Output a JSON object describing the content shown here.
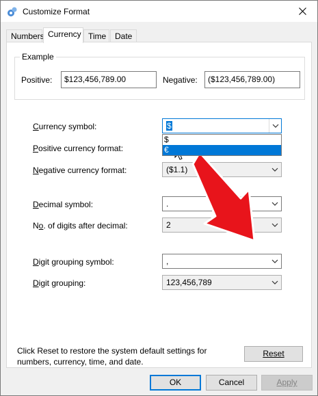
{
  "window": {
    "title": "Customize Format",
    "close_icon": "close-icon"
  },
  "tabs": [
    {
      "label": "Numbers",
      "active": false
    },
    {
      "label": "Currency",
      "active": true
    },
    {
      "label": "Time",
      "active": false
    },
    {
      "label": "Date",
      "active": false
    }
  ],
  "example": {
    "legend": "Example",
    "positive_label": "Positive:",
    "positive_value": "$123,456,789.00",
    "negative_label": "Negative:",
    "negative_value": "($123,456,789.00)"
  },
  "fields": {
    "currency_symbol": {
      "label": "Currency symbol:",
      "value": "$",
      "options": [
        "$",
        "€"
      ],
      "hovered_option": "€"
    },
    "positive_format": {
      "label": "Positive currency format:"
    },
    "negative_format": {
      "label": "Negative currency format:",
      "value": "($1.1)"
    },
    "decimal_symbol": {
      "label": "Decimal symbol:",
      "value": "."
    },
    "digits_after_decimal": {
      "label": "No. of digits after decimal:",
      "value": "2"
    },
    "digit_grouping_symbol": {
      "label": "Digit grouping symbol:",
      "value": ","
    },
    "digit_grouping": {
      "label": "Digit grouping:",
      "value": "123,456,789"
    }
  },
  "reset_note": {
    "line1": "Click Reset to restore the system default settings for",
    "line2": "numbers, currency, time, and date."
  },
  "buttons": {
    "reset": "Reset",
    "ok": "OK",
    "cancel": "Cancel",
    "apply": "Apply"
  },
  "colors": {
    "accent": "#0078d7",
    "annotation_arrow": "#e8141b"
  }
}
